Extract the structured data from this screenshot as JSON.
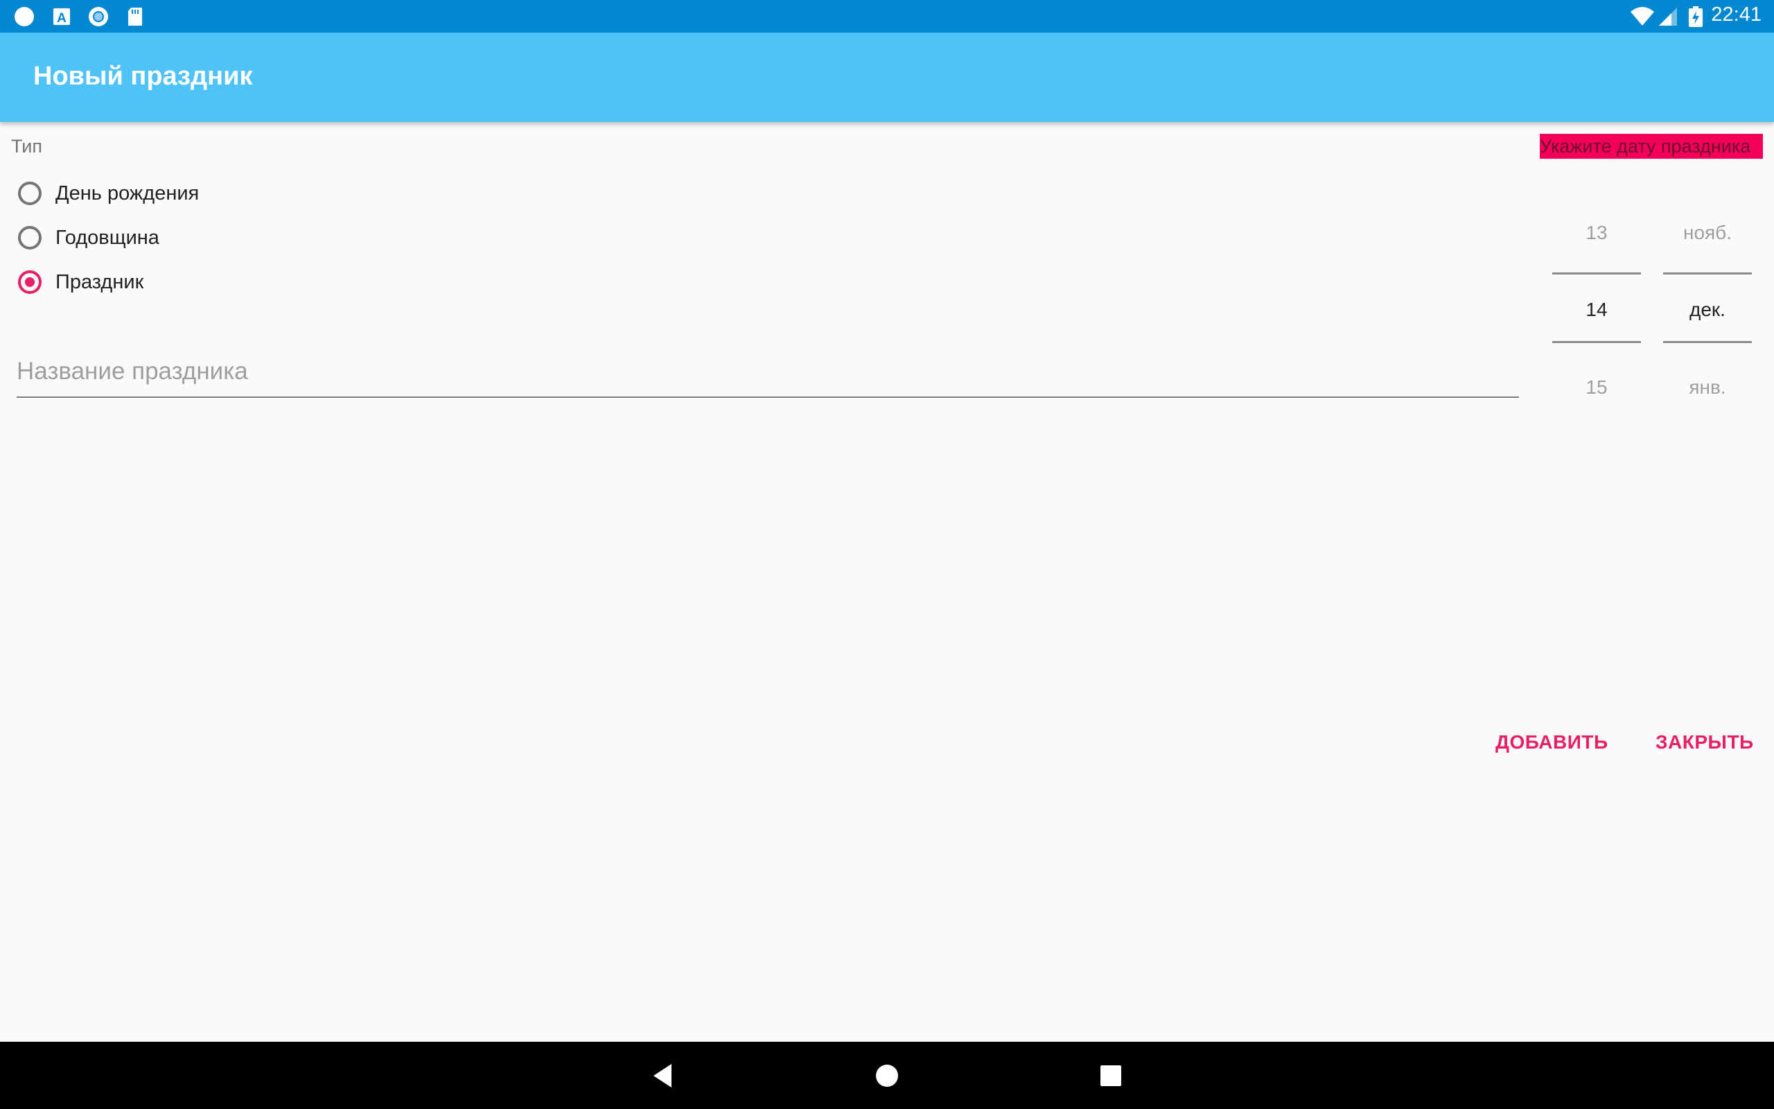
{
  "status_bar": {
    "time": "22:41",
    "colors": {
      "background": "#0288d1"
    },
    "left_icons": [
      "circle-icon",
      "font-a-icon",
      "record-icon",
      "sd-card-icon"
    ],
    "right_icons": [
      "wifi-icon",
      "signal-icon",
      "battery-charging-icon"
    ]
  },
  "app_bar": {
    "title": "Новый праздник",
    "color": "#4fc3f7"
  },
  "form": {
    "type_label": "Тип",
    "radio_options": [
      {
        "label": "День рождения",
        "checked": false
      },
      {
        "label": "Годовщина",
        "checked": false
      },
      {
        "label": "Праздник",
        "checked": true
      }
    ],
    "name_placeholder": "Название праздника",
    "name_value": ""
  },
  "date_picker": {
    "hint": "Укажите дату праздника",
    "day": {
      "prev": "13",
      "current": "14",
      "next": "15"
    },
    "month": {
      "prev": "нояб.",
      "current": "дек.",
      "next": "янв."
    }
  },
  "actions": {
    "add_label": "ДОБАВИТЬ",
    "close_label": "ЗАКРЫТЬ"
  },
  "accent_color": "#e91e63",
  "nav_bar": {
    "icons": [
      "back-icon",
      "home-icon",
      "recents-icon"
    ]
  }
}
